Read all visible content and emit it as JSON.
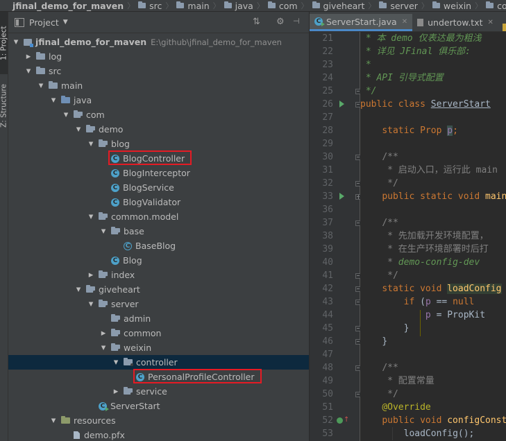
{
  "breadcrumb": [
    "jfinal_demo_for_maven",
    "src",
    "main",
    "java",
    "com",
    "giveheart",
    "server",
    "weixin",
    "controller"
  ],
  "sidebar_tabs": {
    "project": "1: Project",
    "structure": "Z: Structure"
  },
  "project_panel": {
    "title": "Project",
    "tree": [
      {
        "label": "jfinal_demo_for_maven",
        "path": "E:\\github\\jfinal_demo_for_maven",
        "depth": 0,
        "arrow": "open",
        "icon": "module",
        "bold": true
      },
      {
        "label": "log",
        "depth": 1,
        "arrow": "closed",
        "icon": "folder"
      },
      {
        "label": "src",
        "depth": 1,
        "arrow": "open",
        "icon": "folder"
      },
      {
        "label": "main",
        "depth": 2,
        "arrow": "open",
        "icon": "folder"
      },
      {
        "label": "java",
        "depth": 3,
        "arrow": "open",
        "icon": "src-folder"
      },
      {
        "label": "com",
        "depth": 4,
        "arrow": "open",
        "icon": "package"
      },
      {
        "label": "demo",
        "depth": 5,
        "arrow": "open",
        "icon": "package"
      },
      {
        "label": "blog",
        "depth": 6,
        "arrow": "open",
        "icon": "package"
      },
      {
        "label": "BlogController",
        "depth": 7,
        "arrow": "none",
        "icon": "class",
        "highlight": true
      },
      {
        "label": "BlogInterceptor",
        "depth": 7,
        "arrow": "none",
        "icon": "class"
      },
      {
        "label": "BlogService",
        "depth": 7,
        "arrow": "none",
        "icon": "class"
      },
      {
        "label": "BlogValidator",
        "depth": 7,
        "arrow": "none",
        "icon": "class"
      },
      {
        "label": "common.model",
        "depth": 6,
        "arrow": "open",
        "icon": "package"
      },
      {
        "label": "base",
        "depth": 7,
        "arrow": "open",
        "icon": "package"
      },
      {
        "label": "BaseBlog",
        "depth": 8,
        "arrow": "none",
        "icon": "abstract-class"
      },
      {
        "label": "Blog",
        "depth": 7,
        "arrow": "none",
        "icon": "class"
      },
      {
        "label": "index",
        "depth": 6,
        "arrow": "closed",
        "icon": "package"
      },
      {
        "label": "giveheart",
        "depth": 5,
        "arrow": "open",
        "icon": "package"
      },
      {
        "label": "server",
        "depth": 6,
        "arrow": "open",
        "icon": "package"
      },
      {
        "label": "admin",
        "depth": 7,
        "arrow": "none",
        "icon": "package"
      },
      {
        "label": "common",
        "depth": 7,
        "arrow": "closed",
        "icon": "package"
      },
      {
        "label": "weixin",
        "depth": 7,
        "arrow": "open",
        "icon": "package"
      },
      {
        "label": "controller",
        "depth": 8,
        "arrow": "open",
        "icon": "package",
        "selected": true
      },
      {
        "label": "PersonalProfileController",
        "depth": 9,
        "arrow": "none",
        "icon": "class",
        "highlight": true
      },
      {
        "label": "service",
        "depth": 8,
        "arrow": "closed",
        "icon": "package"
      },
      {
        "label": "ServerStart",
        "depth": 6,
        "arrow": "none",
        "icon": "main-class"
      },
      {
        "label": "resources",
        "depth": 3,
        "arrow": "open",
        "icon": "resources-folder"
      },
      {
        "label": "demo.pfx",
        "depth": 4,
        "arrow": "none",
        "icon": "file"
      }
    ]
  },
  "editor": {
    "tabs": [
      {
        "label": "ServerStart.java",
        "active": true
      },
      {
        "label": "undertow.txt",
        "active": false
      }
    ],
    "lines": [
      {
        "n": "21",
        "html": "<span class=\"cm\"> * 本 demo 仅表达最为粗浅"
      },
      {
        "n": "22",
        "html": "<span class=\"cm\"> * 详见 JFinal 俱乐部: </span>"
      },
      {
        "n": "23",
        "html": "<span class=\"cm\"> *</span>"
      },
      {
        "n": "24",
        "html": "<span class=\"cm\"> * API 引导式配置</span>"
      },
      {
        "n": "25",
        "html": "<span class=\"cm\"> */</span>"
      },
      {
        "n": "26",
        "html": "<span class=\"kw\">public class </span><span class=\"typ\" style=\"text-decoration:underline\">ServerStart</span>"
      },
      {
        "n": "27",
        "html": ""
      },
      {
        "n": "28",
        "html": "    <span class=\"kw\">static </span><span class=\"kw\">Prop </span><span class=\"fld hl\">p</span><span class=\"kw\">;</span>"
      },
      {
        "n": "29",
        "html": ""
      },
      {
        "n": "30",
        "html": "    <span class=\"cm2\">/**</span>"
      },
      {
        "n": "31",
        "html": "<span class=\"cm2\">     * 启动入口，运行此 main</span>"
      },
      {
        "n": "32",
        "html": "<span class=\"cm2\">     */</span>"
      },
      {
        "n": "33",
        "html": "    <span class=\"kw\">public static void </span><span class=\"fn\">main</span>"
      },
      {
        "n": "36",
        "html": ""
      },
      {
        "n": "37",
        "html": "    <span class=\"cm2\">/**</span>"
      },
      {
        "n": "38",
        "html": "<span class=\"cm2\">     * 先加载开发环境配置，</span>"
      },
      {
        "n": "39",
        "html": "<span class=\"cm2\">     * 在生产环境部署时后打</span>"
      },
      {
        "n": "40",
        "html": "<span class=\"cm2\">     * </span><span class=\"cm\">demo-config-dev</span>"
      },
      {
        "n": "41",
        "html": "<span class=\"cm2\">     */</span>"
      },
      {
        "n": "42",
        "html": "    <span class=\"kw\">static void </span><span class=\"hlfn\">loadConfig</span>"
      },
      {
        "n": "43",
        "html": "        <span class=\"kw\">if </span><span class=\"plain\">(</span><span class=\"fld\">p </span><span class=\"plain\">== </span><span class=\"kw\">null</span>"
      },
      {
        "n": "44",
        "html": "            <span class=\"fld\">p </span><span class=\"plain\">= PropKit</span>"
      },
      {
        "n": "45",
        "html": "        <span class=\"plain\">}</span>"
      },
      {
        "n": "46",
        "html": "    <span class=\"plain\">}</span>"
      },
      {
        "n": "47",
        "html": ""
      },
      {
        "n": "48",
        "html": "    <span class=\"cm2\">/**</span>"
      },
      {
        "n": "49",
        "html": "<span class=\"cm2\">     * 配置常量</span>"
      },
      {
        "n": "50",
        "html": "<span class=\"cm2\">     */</span>"
      },
      {
        "n": "51",
        "html": "    <span class=\"ann\">@Override</span>"
      },
      {
        "n": "52",
        "html": "    <span class=\"kw\">public void </span><span class=\"fn\">configConstant</span>"
      },
      {
        "n": "53",
        "html": "        <span class=\"plain\">loadConfig();</span>"
      }
    ]
  }
}
